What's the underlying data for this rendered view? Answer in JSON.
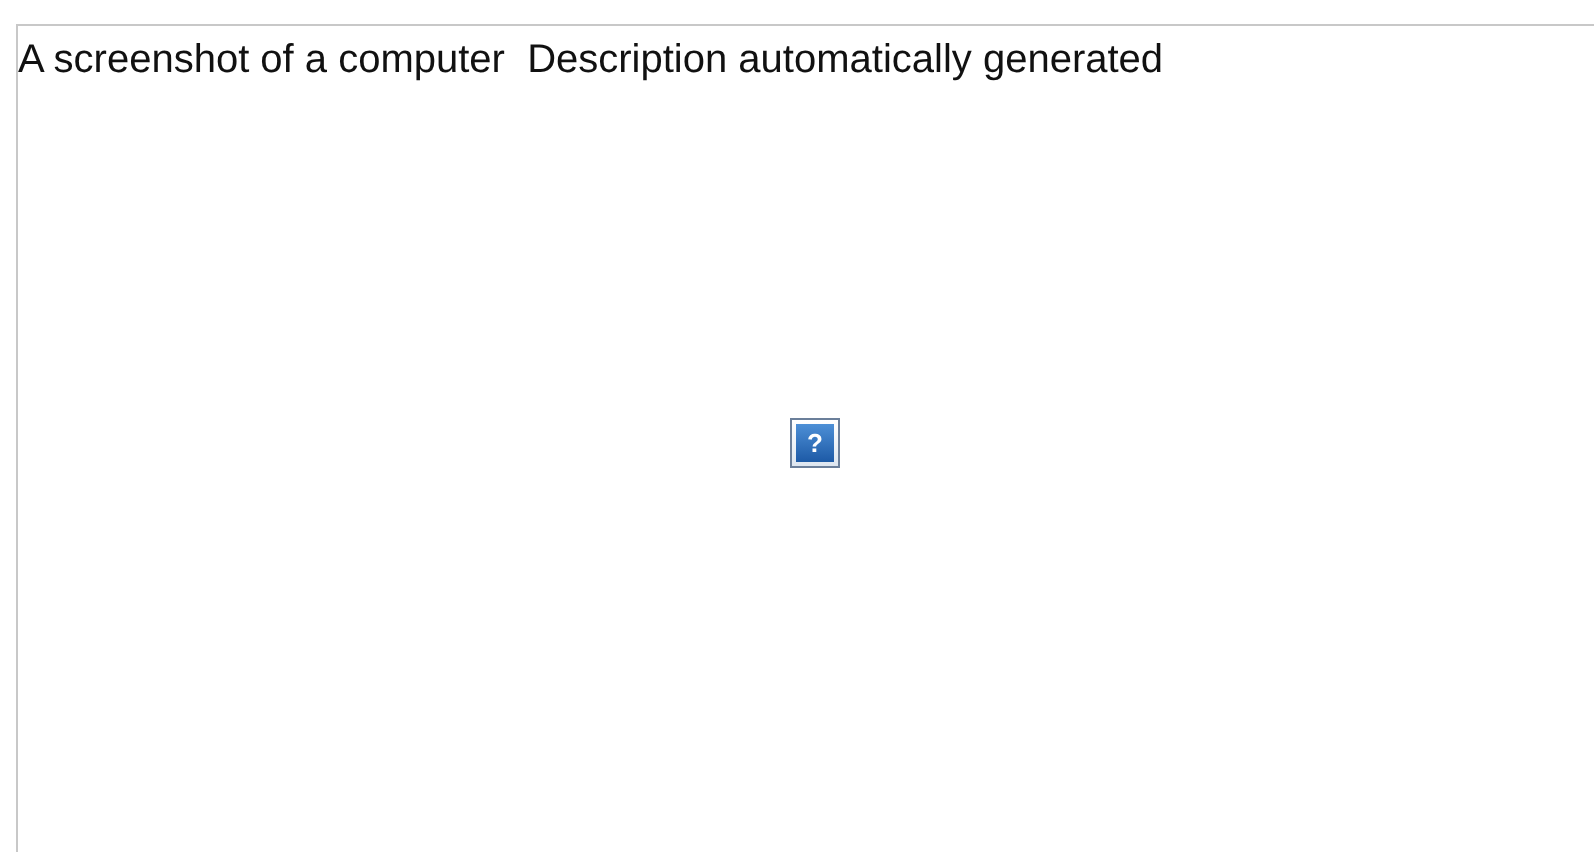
{
  "image_placeholder": {
    "alt_text": "A screenshot of a computer  Description automatically generated",
    "icon_glyph": "?"
  }
}
